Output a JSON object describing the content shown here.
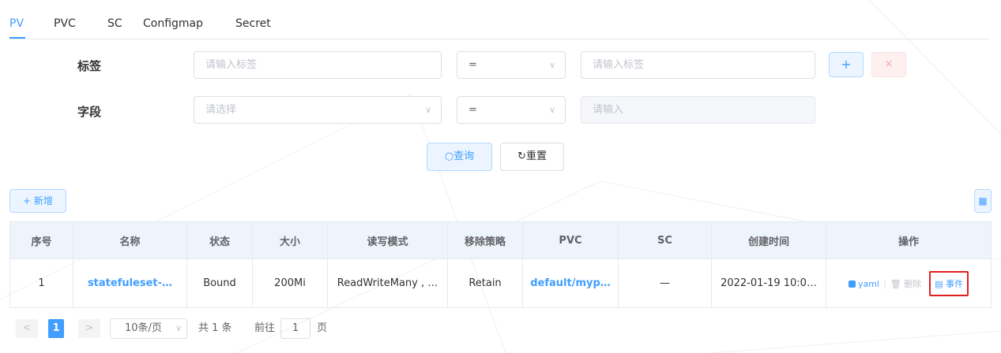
{
  "tabs": [
    {
      "label": "PV",
      "active": true
    },
    {
      "label": "PVC",
      "active": false
    },
    {
      "label": "SC",
      "active": false
    },
    {
      "label": "Configmap",
      "active": false
    },
    {
      "label": "Secret",
      "active": false
    }
  ],
  "filter": {
    "label_row": {
      "label": "标签",
      "key_placeholder": "请输入标签",
      "operator": "=",
      "value_placeholder": "请输入标签",
      "add_symbol": "+",
      "remove_symbol": "×"
    },
    "field_row": {
      "label": "字段",
      "key_placeholder": "请选择",
      "operator": "=",
      "value_placeholder": "请输入"
    },
    "query_label": "查询",
    "reset_label": "重置"
  },
  "toolbar": {
    "new_label": "新增"
  },
  "table": {
    "headers": [
      "序号",
      "名称",
      "状态",
      "大小",
      "读写模式",
      "移除策略",
      "PVC",
      "SC",
      "创建时间",
      "操作"
    ],
    "rows": [
      {
        "index": "1",
        "name": "statefuleset-…",
        "status": "Bound",
        "size": "200Mi",
        "access_mode": "ReadWriteMany , …",
        "reclaim_policy": "Retain",
        "pvc": "default/myp…",
        "sc": "—",
        "created": "2022-01-19 10:0…",
        "actions": {
          "yaml": "yaml",
          "separator": "|",
          "delete": "删除",
          "events": "事件"
        }
      }
    ]
  },
  "pagination": {
    "prev": "<",
    "current": "1",
    "next": ">",
    "page_size": "10条/页",
    "total": "共 1 条",
    "goto_prefix": "前往",
    "goto_value": "1",
    "goto_suffix": "页"
  },
  "colors": {
    "accent": "#409eff",
    "header_bg": "#eef4fc",
    "highlight_border": "#e02020"
  }
}
